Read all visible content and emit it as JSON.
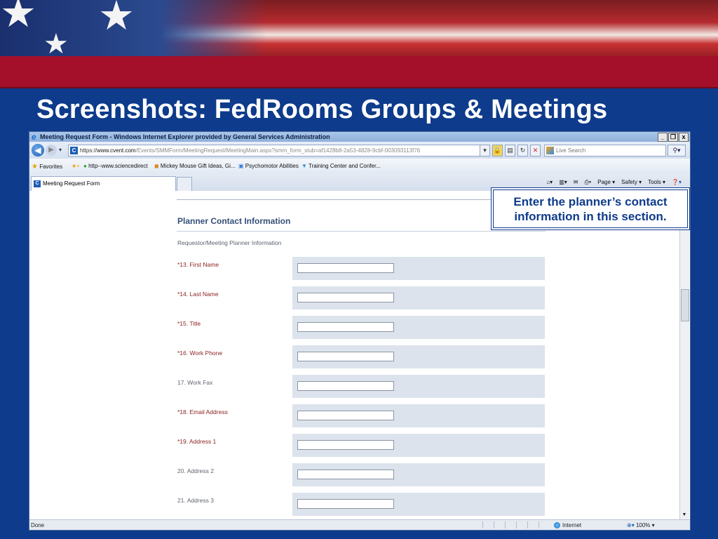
{
  "slide": {
    "title": "Screenshots: FedRooms Groups & Meetings",
    "callout": "Enter the planner’s contact information in this section."
  },
  "browser": {
    "window_title": "Meeting Request Form - Windows Internet Explorer provided by General Services Administration",
    "window_buttons": [
      "_",
      "Ŧ",
      "x"
    ],
    "address": {
      "scheme": "https://",
      "host": "www.cvent.com",
      "path": "/Events/SMMForm/MeetingRequest/MeetingMain.aspx?smm_form_stub=af1428b8-2a53-4828-9cbf-003093113f76"
    },
    "search_placeholder": "Live Search",
    "favorites": {
      "label": "Favorites",
      "links": [
        "http--www.sciencedirect",
        "Mickey Mouse Gift Ideas, Gi...",
        "Psychomotor Abilities",
        "Training Center and Confer..."
      ]
    },
    "tab_label": "Meeting Request Form",
    "command_bar": [
      "Page ▾",
      "Safety ▾",
      "Tools ▾"
    ],
    "status": {
      "text": "Done",
      "zone": "Internet",
      "zoom": "100%"
    }
  },
  "form": {
    "section_title": "Planner Contact Information",
    "subheading": "Requestor/Meeting Planner Information",
    "fields": [
      {
        "label": "*13. First Name",
        "value": "",
        "required": true
      },
      {
        "label": "*14. Last Name",
        "value": "",
        "required": true
      },
      {
        "label": "*15. Title",
        "value": "",
        "required": true
      },
      {
        "label": "*16. Work Phone",
        "value": "",
        "required": true
      },
      {
        "label": "17. Work Fax",
        "value": "",
        "required": false
      },
      {
        "label": "*18. Email Address",
        "value": "",
        "required": true
      },
      {
        "label": "*19. Address 1",
        "value": "",
        "required": true
      },
      {
        "label": "20. Address 2",
        "value": "",
        "required": false
      },
      {
        "label": "21. Address 3",
        "value": "",
        "required": false
      }
    ]
  },
  "colors": {
    "slide_blue": "#0e3b8b",
    "slide_red": "#a4102a",
    "required_label": "#8b1f1f",
    "field_band": "#dce3ec",
    "section_title": "#34507a"
  }
}
